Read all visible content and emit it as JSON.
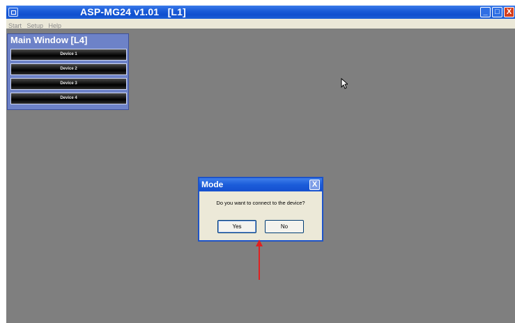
{
  "window": {
    "title": "ASP-MG24 v1.01   [L1]",
    "controls": {
      "minimize": "_",
      "maximize": "□",
      "close": "X"
    }
  },
  "menu": {
    "items": [
      "Start",
      "Setup",
      "Help"
    ]
  },
  "main_window": {
    "title": "Main Window [L4]",
    "devices": [
      "Device 1",
      "Device 2",
      "Device 3",
      "Device 4"
    ]
  },
  "dialog": {
    "title": "Mode",
    "close_glyph": "X",
    "message": "Do you want to connect to the device?",
    "yes_label": "Yes",
    "no_label": "No"
  },
  "colors": {
    "titlebar": "#1a5bd8",
    "workspace": "#7f7f7f",
    "main_window": "#6d82c8",
    "annotation_arrow": "#e02020"
  },
  "icons": [
    "app-icon",
    "mouse-cursor-icon",
    "annotation-arrow"
  ]
}
